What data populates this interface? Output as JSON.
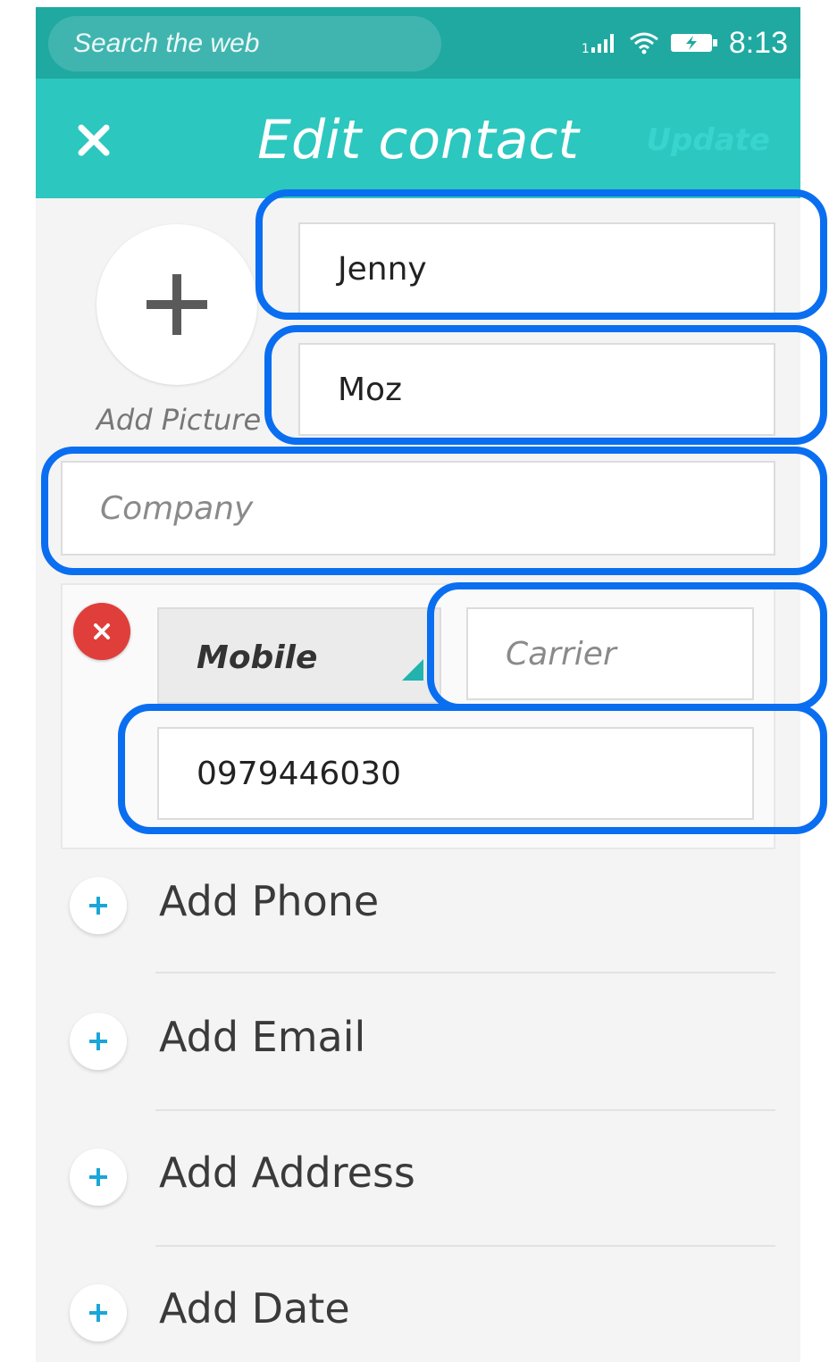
{
  "statusbar": {
    "search_placeholder": "Search the web",
    "sim_number": "1",
    "time": "8:13"
  },
  "header": {
    "title": "Edit contact",
    "update_label": "Update"
  },
  "avatar": {
    "label": "Add Picture"
  },
  "fields": {
    "first_name": "Jenny",
    "last_name": "Moz",
    "company_placeholder": "Company",
    "phone_type": "Mobile",
    "carrier_placeholder": "Carrier",
    "phone_number": "0979446030"
  },
  "add_actions": [
    {
      "label": "Add Phone"
    },
    {
      "label": "Add Email"
    },
    {
      "label": "Add Address"
    },
    {
      "label": "Add Date"
    }
  ],
  "colors": {
    "statusbar": "#1fa9a1",
    "header": "#2cc7bf",
    "highlight": "#0a6ef0",
    "remove": "#e03e3a",
    "plus": "#1aa6d8"
  }
}
